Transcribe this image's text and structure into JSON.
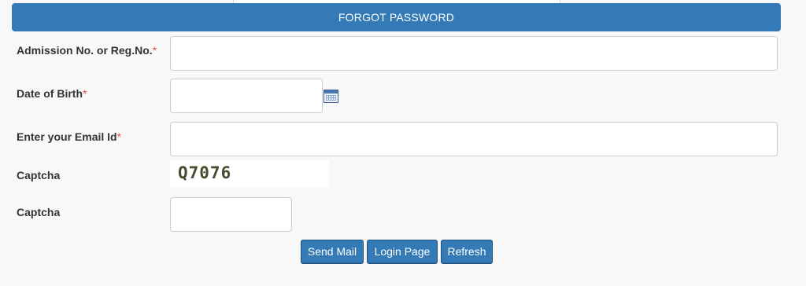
{
  "form": {
    "title": "FORGOT PASSWORD",
    "required_mark": "*",
    "admission_label": "Admission No. or Reg.No.",
    "admission_value": "",
    "dob_label": "Date of Birth",
    "dob_value": "",
    "email_label": "Enter your Email Id",
    "email_value": "",
    "captcha_label": "Captcha",
    "captcha_code": "Q7076",
    "captcha_input_label": "Captcha",
    "captcha_input_value": ""
  },
  "buttons": {
    "send_mail": "Send Mail",
    "login_page": "Login Page",
    "refresh": "Refresh"
  },
  "colors": {
    "primary": "#337ab7",
    "required": "#d9534f"
  },
  "icons": {
    "date_picker": "calendar-icon"
  }
}
